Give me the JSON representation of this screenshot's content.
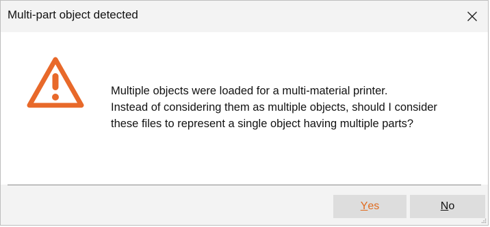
{
  "window": {
    "title": "Multi-part object detected"
  },
  "message": {
    "lines": [
      "Multiple objects were loaded for a multi-material printer.",
      "Instead of considering them as multiple objects, should I consider",
      "these files to represent a single object having multiple parts?"
    ]
  },
  "buttons": {
    "yes": {
      "mnemonic": "Y",
      "rest": "es"
    },
    "no": {
      "mnemonic": "N",
      "rest": "o"
    }
  },
  "icons": {
    "warning": "warning-triangle-icon",
    "close": "close-icon"
  },
  "colors": {
    "accent": "#e8692a",
    "yes_text": "#e06a1e",
    "button_bg": "#dddddd",
    "chrome_bg": "#f3f3f3"
  }
}
